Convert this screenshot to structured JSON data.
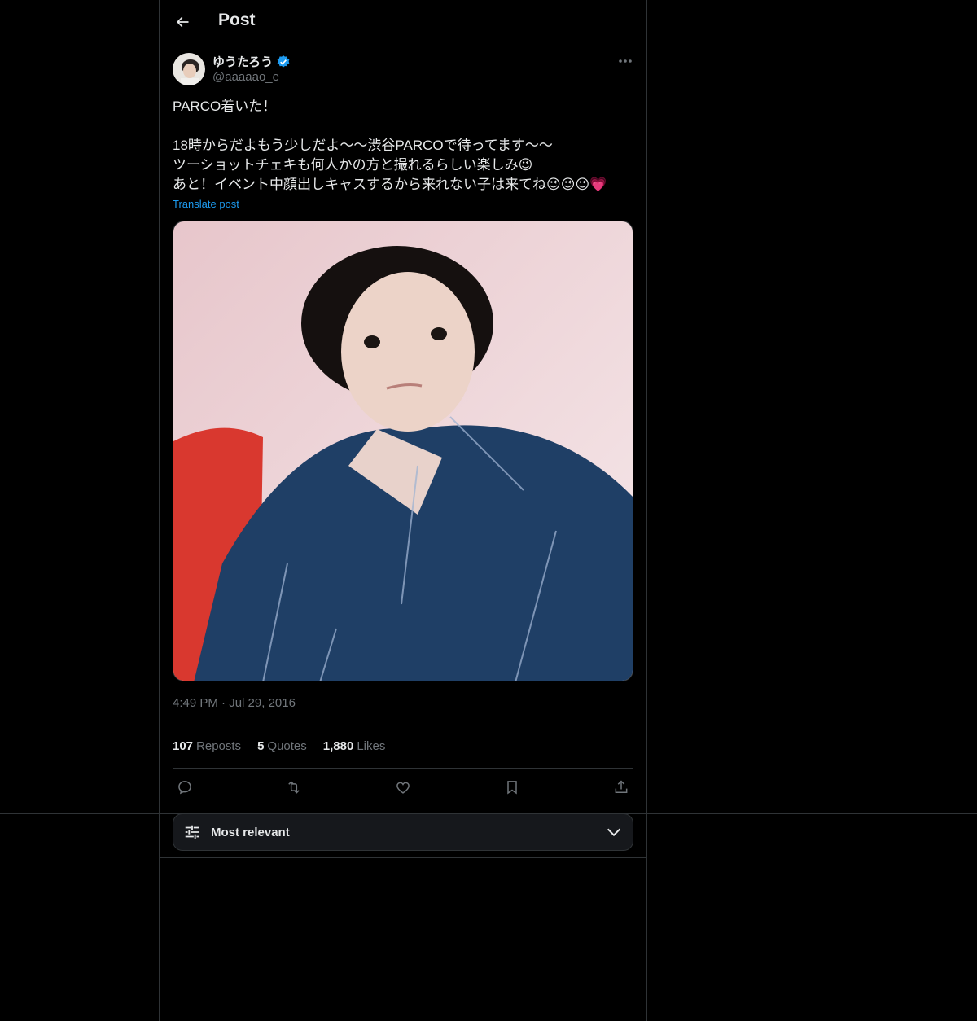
{
  "header": {
    "title": "Post"
  },
  "author": {
    "display_name": "ゆうたろう",
    "handle": "@aaaaao_e",
    "verified": true
  },
  "tweet": {
    "lines": [
      "PARCO着いた！",
      "",
      "18時からだよもう少しだよ〜〜渋谷PARCOで待ってます〜〜",
      "ツーショットチェキも何人かの方と撮れるらしい楽しみ😉",
      "あと！イベント中顔出しキャスするから来れない子は来てね😉😉😉💗"
    ],
    "translate_label": "Translate post",
    "time": "4:49 PM",
    "separator": "·",
    "date": "Jul 29, 2016"
  },
  "stats": {
    "reposts_count": "107",
    "reposts_label": "Reposts",
    "quotes_count": "5",
    "quotes_label": "Quotes",
    "likes_count": "1,880",
    "likes_label": "Likes"
  },
  "actions": [
    "reply-icon",
    "repost-icon",
    "like-icon",
    "bookmark-icon",
    "share-icon"
  ],
  "sort": {
    "label": "Most relevant"
  },
  "colors": {
    "background": "#000000",
    "accent": "#1d9bf0",
    "text": "#e7e9ea",
    "secondary": "#71767b",
    "border": "#2f3336"
  }
}
